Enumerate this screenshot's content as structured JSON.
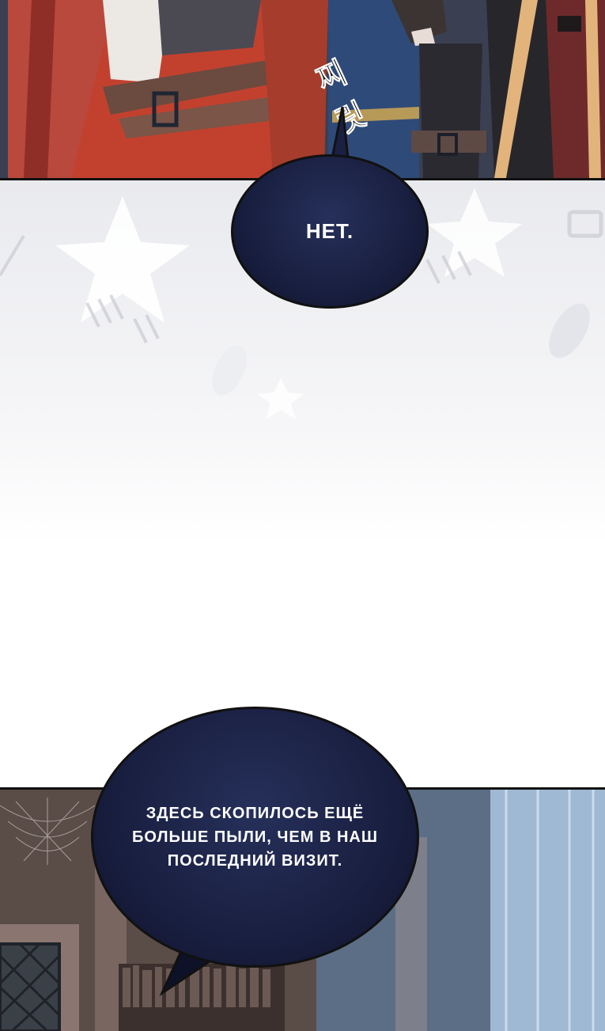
{
  "panels": {
    "top": {
      "description_role": "illustration"
    },
    "bottom": {
      "description_role": "illustration"
    }
  },
  "sfx": {
    "text": "찌릿",
    "color": "#000000"
  },
  "bubble_one": {
    "text": "НЕТ."
  },
  "bubble_two": {
    "text": "ЗДЕСЬ СКОПИЛОСЬ ЕЩЁ БОЛЬШЕ ПЫЛИ, ЧЕМ В НАШ ПОСЛЕДНИЙ ВИЗИТ."
  },
  "colors": {
    "bubble": "#1a2042",
    "bubble_text": "#ffffff",
    "outline": "#111111"
  }
}
